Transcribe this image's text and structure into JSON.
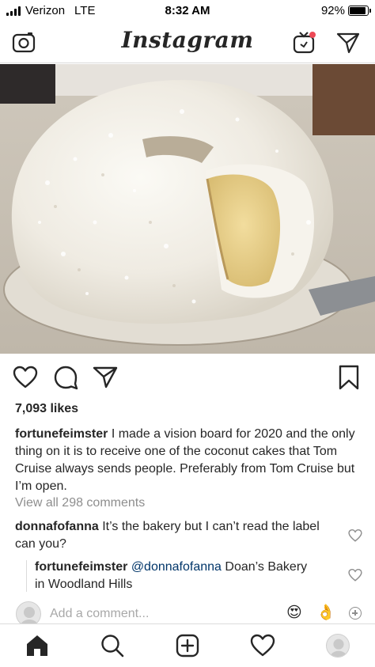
{
  "status_bar": {
    "carrier": "Verizon",
    "network": "LTE",
    "time": "8:32 AM",
    "battery_percent": "92%",
    "battery_level": 0.92
  },
  "header": {
    "title": "Instagram",
    "left_icon": "camera-icon",
    "right_icons": [
      "igtv-icon",
      "direct-message-icon"
    ]
  },
  "post": {
    "image_alt": "coconut bundt cake",
    "actions": [
      "heart-icon",
      "comment-icon",
      "share-icon",
      "bookmark-icon"
    ],
    "likes": "7,093 likes",
    "caption": {
      "username": "fortunefeimster",
      "text": "I made a vision board for 2020 and the only thing on it is to receive one of the coconut cakes that Tom Cruise always sends people. Preferably from Tom Cruise but I’m open."
    },
    "view_all_comments": "View all 298 comments",
    "comments": [
      {
        "username": "donnafofanna",
        "text": "It’s the bakery but I can’t read the label can you?"
      },
      {
        "username": "fortunefeimster",
        "mention": "@donnafofanna",
        "text": "Doan’s Bakery in Woodland Hills"
      }
    ],
    "add_comment_placeholder": "Add a comment...",
    "quick_emojis": [
      "😍",
      "👌"
    ]
  },
  "bottom_nav": [
    "home-icon",
    "search-icon",
    "new-post-icon",
    "activity-icon",
    "profile-avatar"
  ],
  "colors": {
    "text": "#262626",
    "muted": "#8e8e8e",
    "mention": "#003569",
    "divider": "#dbdbdb",
    "igtv_badge": "#ed4956"
  }
}
